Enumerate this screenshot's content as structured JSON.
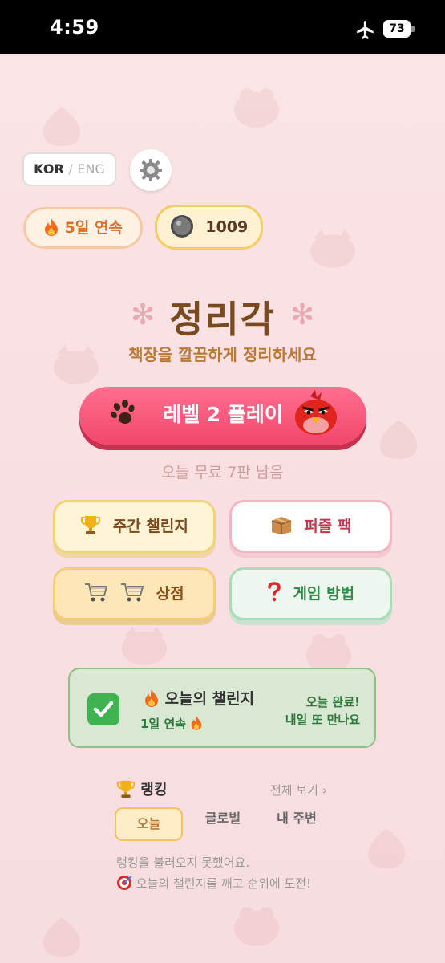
{
  "status": {
    "time": "4:59",
    "battery": "73"
  },
  "lang": {
    "kor": "KOR",
    "sep": "/",
    "eng": "ENG"
  },
  "stats": {
    "streak": "5일 연속",
    "coins": "1009"
  },
  "header": {
    "title": "정리각",
    "subtitle": "책장을 깔끔하게 정리하세요"
  },
  "play": {
    "label": "레벨 2 플레이",
    "free_text": "오늘 무료 7판 남음"
  },
  "menu": {
    "weekly": "주간 챌린지",
    "puzzle": "퍼즐 팩",
    "shop": "상점",
    "howto": "게임 방법"
  },
  "challenge": {
    "title": "오늘의 챌린지",
    "streak": "1일 연속",
    "done_line1": "오늘 완료!",
    "done_line2": "내일 또 만나요"
  },
  "ranking": {
    "title": "랭킹",
    "view_all": "전체 보기 ›",
    "tabs": [
      "오늘",
      "글로벌",
      "내 주변"
    ],
    "error": "랭킹을 불러오지 못했어요.",
    "cta": "오늘의 챌린지를 깨고 순위에 도전!"
  },
  "colors": {
    "accent": "#f2466c",
    "title": "#7a4a1f",
    "success": "#3fb34f"
  },
  "icons": [
    "airplane-icon",
    "gear-icon",
    "fire-icon",
    "coin-icon",
    "paw-icon",
    "red-bird-icon",
    "trophy-icon",
    "box-icon",
    "cart-icon",
    "question-icon",
    "checkmark-icon",
    "target-icon"
  ]
}
